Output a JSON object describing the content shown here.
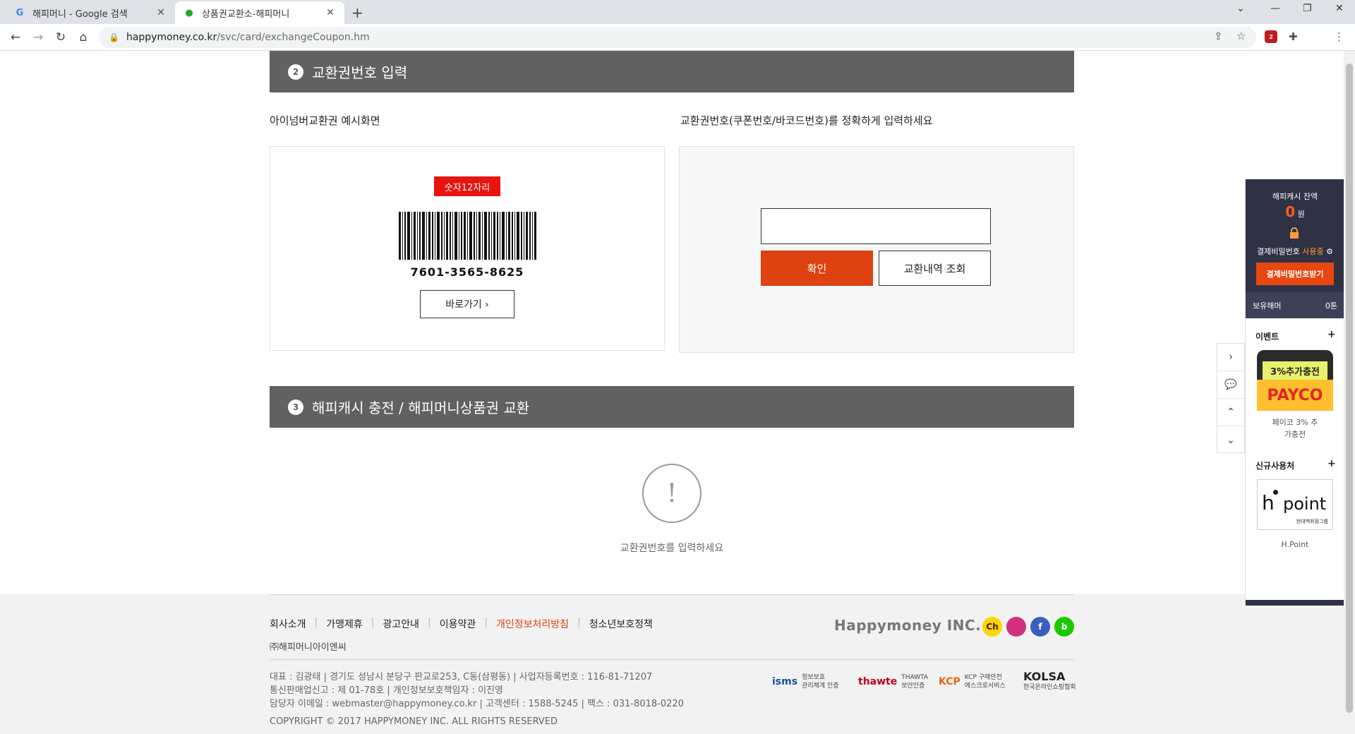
{
  "browser": {
    "tabs": [
      {
        "title": "해피머니 - Google 검색",
        "favicon": "G"
      },
      {
        "title": "상품권교환소-해피머니",
        "favicon": "●"
      }
    ],
    "url_host": "happymoney.co.kr",
    "url_path": "/svc/card/exchangeCoupon.hm",
    "abp_count": "2"
  },
  "section2": {
    "num": "2",
    "title": "교환권번호 입력",
    "example_title": "아이넘버교환권 예시화면",
    "input_title": "교환권번호(쿠폰번호/바코드번호)를 정확하게 입력하세요",
    "badge": "숫자12자리",
    "barcode_number": "7601-3565-8625",
    "goto_label": "바로가기 ›",
    "input_value": "",
    "input_placeholder": "",
    "confirm_label": "확인",
    "history_label": "교환내역 조회"
  },
  "section3": {
    "num": "3",
    "title": "해피캐시 충전 / 해피머니상품권 교환",
    "warning_symbol": "!",
    "warning_text": "교환권번호를 입력하세요"
  },
  "footer": {
    "links": [
      "회사소개",
      "가맹제휴",
      "광고안내",
      "이용약관",
      "개인정보처리방침",
      "청소년보호정책"
    ],
    "corp": "㈜해피머니아이엔씨",
    "info1": "대표 : 김광태 | 경기도 성남시 분당구 판교로253, C동(삼평동) | 사업자등록번호 : 116-81-71207",
    "info2": "통신판매업신고 : 제 01-78호 | 개인정보보호책임자 : 이진영",
    "info3": "담당자 이메일 : webmaster@happymoney.co.kr | 고객센터 : 1588-5245 | 팩스 : 031-8018-0220",
    "copyright": "COPYRIGHT © 2017 HAPPYMONEY INC. ALL RIGHTS RESERVED",
    "logo": "Happymoney INC.",
    "sns": [
      "Ch",
      "",
      "f",
      "b"
    ],
    "certs": [
      {
        "mark": "isms",
        "text1": "정보보호",
        "text2": "관리체계 인증"
      },
      {
        "mark": "thawte",
        "text1": "THAWTA",
        "text2": "보안인증"
      },
      {
        "mark": "KCP",
        "text1": "KCP 구매안전",
        "text2": "에스크로서비스"
      },
      {
        "mark": "KOLSA",
        "text1": "",
        "text2": "한국온라인쇼핑협회"
      }
    ]
  },
  "quick": {
    "cash_label": "해피캐시 잔액",
    "cash_value": "0",
    "cash_unit": "원",
    "pw_label": "결제비밀번호",
    "pw_status": "사용중",
    "pw_button": "결제비밀번호받기",
    "hold_label": "보유해머",
    "hold_value": "0톤",
    "event_title": "이벤트",
    "event_banner_top": "3%추가충전",
    "event_banner_bottom": "PAYCO",
    "event_caption": "페이코 3% 추",
    "event_caption2": "가충전",
    "new_title": "신규사용처",
    "hpoint_h": "h",
    "hpoint_pt": "point",
    "hpoint_group": "현대백화점그룹",
    "hpoint_caption": "H.Point",
    "plus": "+"
  },
  "colors": {
    "section_header": "#616161",
    "confirm": "#dd4210",
    "badge": "#e8140f",
    "quick_panel": "#2f3245"
  }
}
